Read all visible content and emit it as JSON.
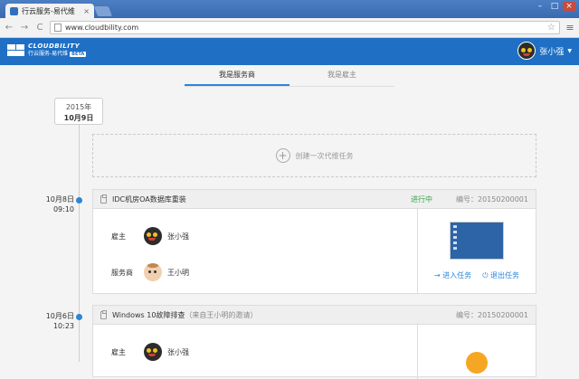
{
  "browser": {
    "tab_title": "行云服务-易代维",
    "tab_close": "×",
    "url": "www.cloudbility.com",
    "nav": {
      "back": "←",
      "forward": "→",
      "reload": "C"
    },
    "star": "☆",
    "menu": "≡",
    "window_controls": {
      "min": "–",
      "max": "□",
      "close": "×"
    }
  },
  "app": {
    "logo_brand": "CLOUDBILITY",
    "logo_sub": "行云服务-易代维",
    "logo_badge": "BETA",
    "user_name": "张小强",
    "caret": "▼",
    "accent_color": "#1f6fc4"
  },
  "tabs": [
    {
      "label": "我是服务商",
      "active": true
    },
    {
      "label": "我是雇主",
      "active": false
    }
  ],
  "timeline": {
    "year": "2015年",
    "day": "10月9日",
    "create_label": "创建一次代维任务",
    "create_icon": "+"
  },
  "tasks": [
    {
      "date": "10月8日",
      "time": "09:10",
      "title": "IDC机房OA数据库重装",
      "note": "",
      "status": "进行中",
      "code": "编号：20150200001",
      "employer_role": "雇主",
      "employer_name": "张小强",
      "provider_role": "服务商",
      "provider_name": "王小明",
      "enter_label": "→ 进入任务",
      "exit_label": "⏻ 退出任务"
    },
    {
      "date": "10月6日",
      "time": "10:23",
      "title": "Windows 10故障排查",
      "note": "（来自王小明的邀请）",
      "status": "",
      "code": "编号：20150200001",
      "employer_role": "雇主",
      "employer_name": "张小强"
    }
  ]
}
